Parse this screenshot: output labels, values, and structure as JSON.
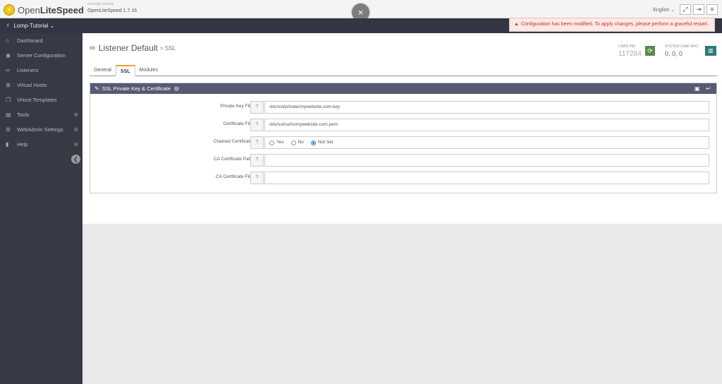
{
  "header": {
    "logo_text_light": "Open",
    "logo_text_bold": "LiteSpeed",
    "version_label": "currently running",
    "version_value": "OpenLiteSpeed 1.7.16",
    "close_glyph": "×",
    "language": "English",
    "icons": [
      "fullscreen-icon",
      "logout-icon",
      "menu-icon"
    ]
  },
  "server_bar": {
    "name": "Lomp-Tutorial",
    "notice": "Configuration has been modified. To apply changes, please perform a graceful restart."
  },
  "sidebar": {
    "items": [
      {
        "label": "Dashboard",
        "icon": "home-icon",
        "glyph": "⌂",
        "expandable": false
      },
      {
        "label": "Server Configuration",
        "icon": "globe-icon",
        "glyph": "◉",
        "expandable": false
      },
      {
        "label": "Listeners",
        "icon": "link-icon",
        "glyph": "∞",
        "expandable": false
      },
      {
        "label": "Virtual Hosts",
        "icon": "sitemap-icon",
        "glyph": "⊞",
        "expandable": false
      },
      {
        "label": "VHost Templates",
        "icon": "copy-icon",
        "glyph": "❐",
        "expandable": false
      },
      {
        "label": "Tools",
        "icon": "toolbox-icon",
        "glyph": "▤",
        "expandable": true
      },
      {
        "label": "WebAdmin Settings",
        "icon": "gear-icon",
        "glyph": "⚙",
        "expandable": true
      },
      {
        "label": "Help",
        "icon": "book-icon",
        "glyph": "▮",
        "expandable": true
      }
    ]
  },
  "page": {
    "title": "Listener Default",
    "subtitle": "> SSL",
    "pid_label": "LSWS PID",
    "pid_value": "117284",
    "load_label": "SYSTEM LOAD AVG",
    "load_value": "0, 0, 0"
  },
  "tabs": [
    {
      "label": "General",
      "active": false
    },
    {
      "label": "SSL",
      "active": true
    },
    {
      "label": "Modules",
      "active": false
    }
  ],
  "panel": {
    "title": "SSL Private Key & Certificate",
    "rows": [
      {
        "label": "Private Key File",
        "value": "/etc/ssl/private/mywebsite.com.key",
        "type": "text"
      },
      {
        "label": "Certificate File",
        "value": "/etc/ssl/certs/mywebsite.com.pem",
        "type": "text"
      },
      {
        "label": "Chained Certificate",
        "type": "radio",
        "options": [
          "Yes",
          "No",
          "Not Set"
        ],
        "selected": "Not Set"
      },
      {
        "label": "CA Certificate Path",
        "value": "",
        "type": "text"
      },
      {
        "label": "CA Certificate File",
        "value": "",
        "type": "text"
      }
    ]
  }
}
